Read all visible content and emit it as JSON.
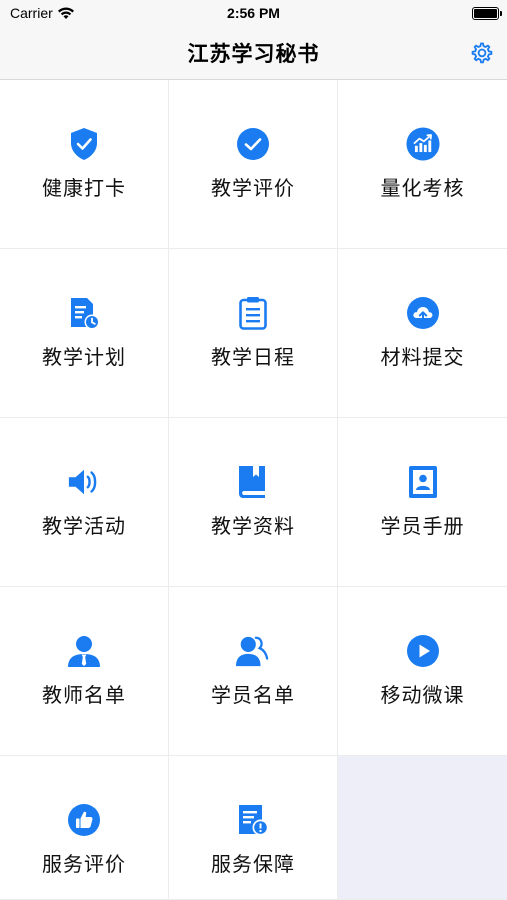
{
  "status_bar": {
    "carrier": "Carrier",
    "time": "2:56 PM"
  },
  "nav": {
    "title": "江苏学习秘书",
    "settings_icon": "gear-icon"
  },
  "accent_color": "#1a7cf0",
  "grid_items": [
    {
      "label": "健康打卡",
      "icon": "shield-check-icon"
    },
    {
      "label": "教学评价",
      "icon": "check-circle-icon"
    },
    {
      "label": "量化考核",
      "icon": "chart-circle-icon"
    },
    {
      "label": "教学计划",
      "icon": "document-clock-icon"
    },
    {
      "label": "教学日程",
      "icon": "clipboard-icon"
    },
    {
      "label": "材料提交",
      "icon": "cloud-upload-icon"
    },
    {
      "label": "教学活动",
      "icon": "speaker-icon"
    },
    {
      "label": "教学资料",
      "icon": "book-icon"
    },
    {
      "label": "学员手册",
      "icon": "contact-book-icon"
    },
    {
      "label": "教师名单",
      "icon": "teacher-icon"
    },
    {
      "label": "学员名单",
      "icon": "students-icon"
    },
    {
      "label": "移动微课",
      "icon": "play-circle-icon"
    },
    {
      "label": "服务评价",
      "icon": "thumbs-up-icon"
    },
    {
      "label": "服务保障",
      "icon": "document-alert-icon"
    }
  ]
}
